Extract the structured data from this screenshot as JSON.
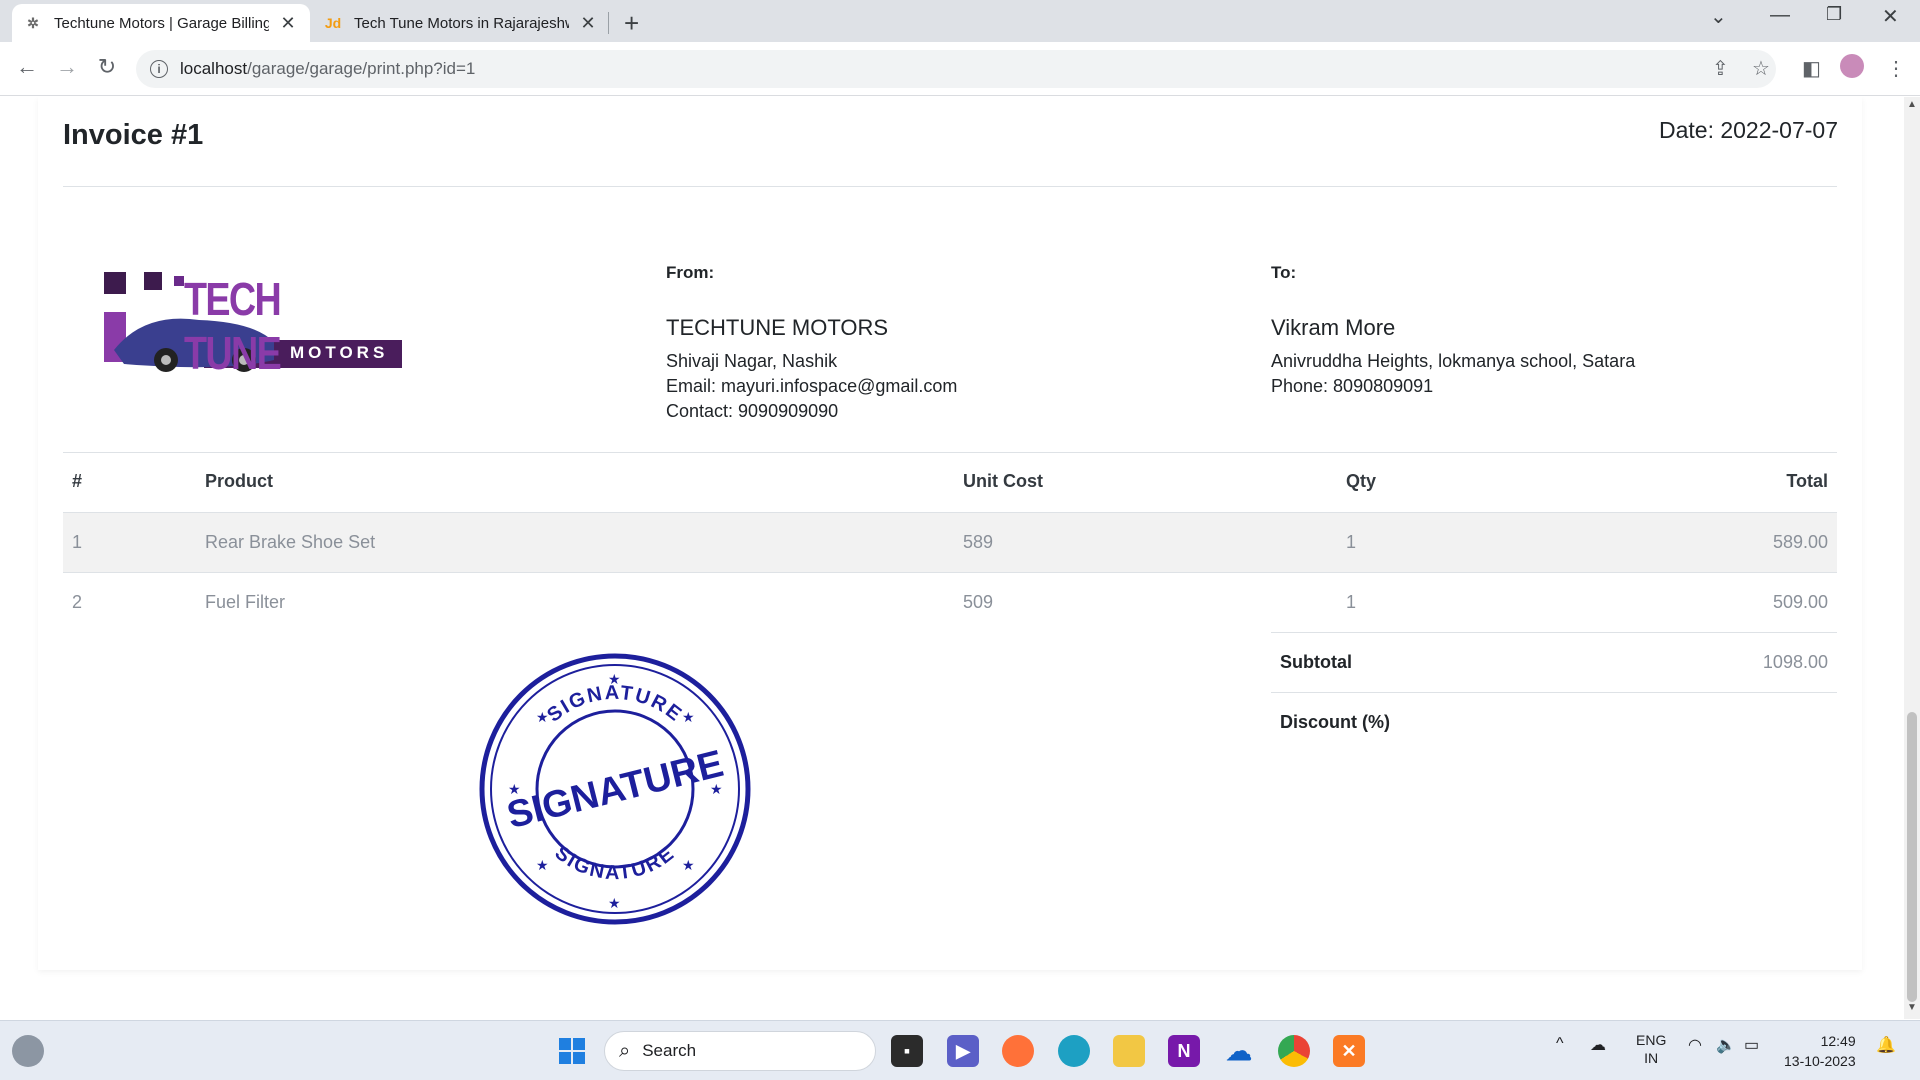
{
  "browser": {
    "tabs": [
      {
        "title": "Techtune Motors | Garage Billing",
        "favicon": "gear-favicon"
      },
      {
        "title": "Tech Tune Motors in Rajarajeshw",
        "favicon": "jd-favicon",
        "favicon_text": "Jd"
      }
    ],
    "url_host": "localhost",
    "url_path": "/garage/garage/print.php?id=1"
  },
  "invoice": {
    "title": "Invoice #1",
    "date": "Date: 2022-07-07",
    "logo": {
      "line1": "TECH TUNE",
      "line2": "MOTORS"
    },
    "from": {
      "label": "From:",
      "name": "TECHTUNE MOTORS",
      "address": "Shivaji Nagar, Nashik",
      "email": "Email: mayuri.infospace@gmail.com",
      "contact": "Contact: 9090909090"
    },
    "to": {
      "label": "To:",
      "name": "Vikram More",
      "address": "Anivruddha Heights, lokmanya school, Satara",
      "phone": "Phone: 8090809091"
    },
    "table": {
      "headers": [
        "#",
        "Product",
        "Unit Cost",
        "Qty",
        "Total"
      ],
      "rows": [
        [
          "1",
          "Rear Brake Shoe Set",
          "589",
          "1",
          "589.00"
        ],
        [
          "2",
          "Fuel Filter",
          "509",
          "1",
          "509.00"
        ]
      ]
    },
    "subtotal_label": "Subtotal",
    "subtotal_value": "1098.00",
    "discount_label": "Discount (%)",
    "stamp": {
      "center": "SIGNATURE",
      "ring": "SIGNATURE"
    }
  },
  "taskbar": {
    "search_label": "Search",
    "lang_line1": "ENG",
    "lang_line2": "IN",
    "time": "12:49",
    "date": "13-10-2023"
  }
}
